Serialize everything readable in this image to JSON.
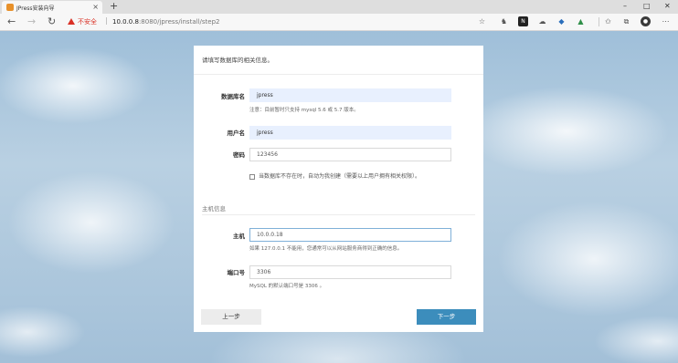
{
  "browser": {
    "tab_title": "JPress安装向导",
    "tab_close": "×",
    "new_tab": "+",
    "window_controls": [
      "–",
      "□",
      "✕"
    ],
    "security_label": "不安全",
    "url_host": "10.0.0.8",
    "url_path": ":8080/jpress/install/step2",
    "toolbar_icons": [
      "star-icon",
      "extension-icon-1",
      "extension-icon-2",
      "extension-icon-3",
      "extension-icon-4",
      "extension-icon-5",
      "favorites-icon",
      "collections-icon",
      "profile-icon",
      "menu-icon"
    ]
  },
  "form": {
    "title": "请填写数据库的相关信息。",
    "db_name_label": "数据库名",
    "db_name_value": "jpress",
    "db_name_help": "注意：目前暂时只支持 mysql 5.6 或 5.7 版本。",
    "user_label": "用户名",
    "user_value": "jpress",
    "password_label": "密码",
    "password_value": "123456",
    "create_db_checkbox": "当数据库不存在时，自动为我创建（需要以上用户拥有相关权限）。",
    "host_section_title": "主机信息",
    "host_label": "主机",
    "host_value": "10.0.0.18",
    "host_help": "如果 127.0.0.1 不能用，您通常可以从网站服务商得到正确的信息。",
    "port_label": "端口号",
    "port_value": "3306",
    "port_help": "MySQL 的默认端口号是 3306 。",
    "prev_button": "上一步",
    "next_button": "下一步"
  }
}
